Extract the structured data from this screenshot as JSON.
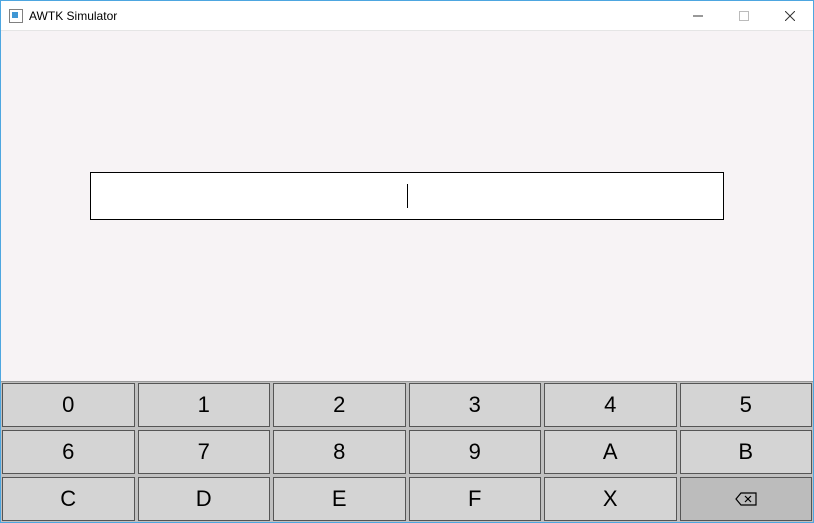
{
  "window": {
    "title": "AWTK Simulator"
  },
  "input": {
    "value": ""
  },
  "keyboard": {
    "rows": [
      [
        "0",
        "1",
        "2",
        "3",
        "4",
        "5"
      ],
      [
        "6",
        "7",
        "8",
        "9",
        "A",
        "B"
      ],
      [
        "C",
        "D",
        "E",
        "F",
        "X"
      ]
    ]
  }
}
